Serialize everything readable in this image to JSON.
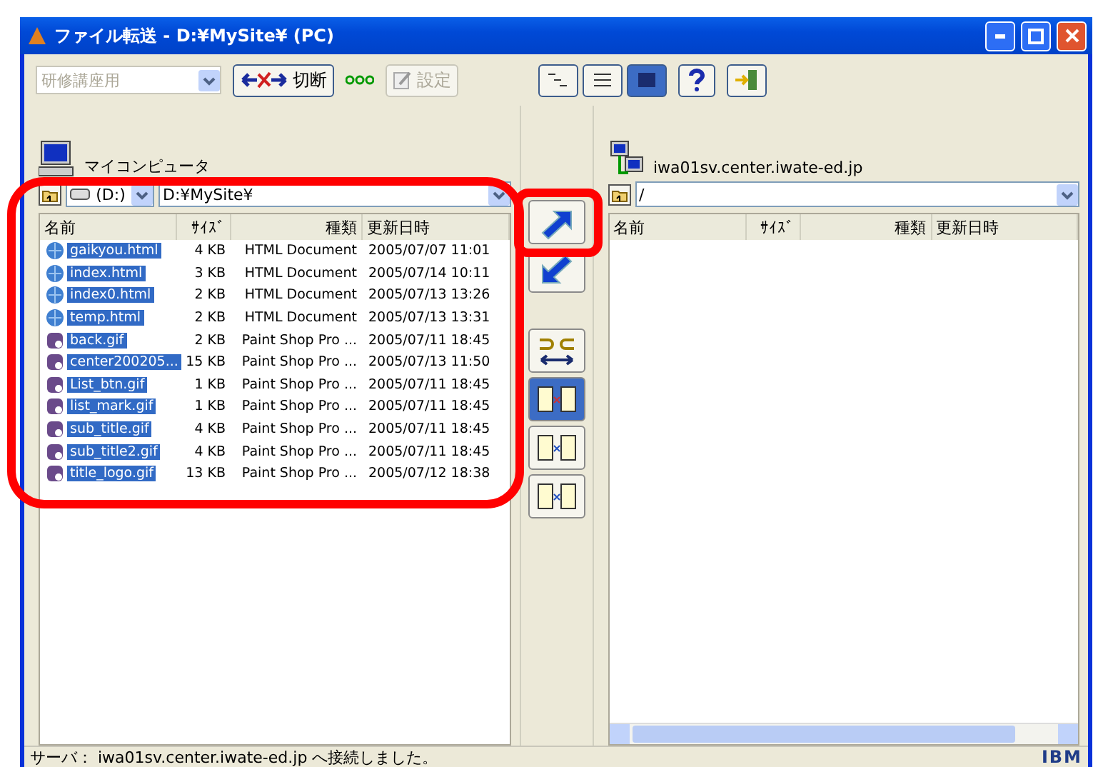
{
  "window": {
    "title": "ファイル転送 - D:¥MySite¥ (PC)"
  },
  "toolbar": {
    "profile": {
      "value": "研修講座用",
      "disabled": true
    },
    "disconnect": {
      "label": "切断",
      "disabled": false
    },
    "settings": {
      "label": "設定",
      "disabled": true
    },
    "views": [
      {
        "kind": "list",
        "selected": false
      },
      {
        "kind": "detail",
        "selected": false
      },
      {
        "kind": "grid",
        "selected": true
      }
    ]
  },
  "local": {
    "title": "マイコンピュータ",
    "drive": "(D:)",
    "path": "D:¥MySite¥",
    "highlighted": true,
    "columns": [
      "名前",
      "ｻｲｽﾞ",
      "種類",
      "更新日時"
    ],
    "rows": [
      {
        "kind": "html",
        "name": "gaikyou.html",
        "size": "4 KB",
        "type": "HTML Document",
        "modified": "2005/07/07 11:01",
        "selected": true
      },
      {
        "kind": "html",
        "name": "index.html",
        "size": "3 KB",
        "type": "HTML Document",
        "modified": "2005/07/14 10:11",
        "selected": true
      },
      {
        "kind": "html",
        "name": "index0.html",
        "size": "2 KB",
        "type": "HTML Document",
        "modified": "2005/07/13 13:26",
        "selected": true
      },
      {
        "kind": "html",
        "name": "temp.html",
        "size": "2 KB",
        "type": "HTML Document",
        "modified": "2005/07/13 13:31",
        "selected": true
      },
      {
        "kind": "image",
        "name": "back.gif",
        "size": "2 KB",
        "type": "Paint Shop Pro ...",
        "modified": "2005/07/11 18:45",
        "selected": true
      },
      {
        "kind": "image",
        "name": "center200205...",
        "size": "15 KB",
        "type": "Paint Shop Pro ...",
        "modified": "2005/07/13 11:50",
        "selected": true
      },
      {
        "kind": "image",
        "name": "List_btn.gif",
        "size": "1 KB",
        "type": "Paint Shop Pro ...",
        "modified": "2005/07/11 18:45",
        "selected": true
      },
      {
        "kind": "image",
        "name": "list_mark.gif",
        "size": "1 KB",
        "type": "Paint Shop Pro ...",
        "modified": "2005/07/11 18:45",
        "selected": true
      },
      {
        "kind": "image",
        "name": "sub_title.gif",
        "size": "4 KB",
        "type": "Paint Shop Pro ...",
        "modified": "2005/07/11 18:45",
        "selected": true
      },
      {
        "kind": "image",
        "name": "sub_title2.gif",
        "size": "4 KB",
        "type": "Paint Shop Pro ...",
        "modified": "2005/07/11 18:45",
        "selected": true
      },
      {
        "kind": "image",
        "name": "title_logo.gif",
        "size": "13 KB",
        "type": "Paint Shop Pro ...",
        "modified": "2005/07/12 18:38",
        "selected": true
      }
    ]
  },
  "transfer": {
    "upload": {
      "highlighted": true
    },
    "modes": [
      {
        "kind": "sync",
        "selected": false
      },
      {
        "kind": "binary-text",
        "selected": true
      },
      {
        "kind": "binary",
        "selected": false
      },
      {
        "kind": "text",
        "selected": false
      }
    ]
  },
  "remote": {
    "title": "iwa01sv.center.iwate-ed.jp",
    "path": "/",
    "columns": [
      "名前",
      "ｻｲｽﾞ",
      "種類",
      "更新日時"
    ]
  },
  "status_bar": {
    "message": "サーバ： iwa01sv.center.iwate-ed.jp へ接続しました。",
    "logo": "IBM"
  }
}
